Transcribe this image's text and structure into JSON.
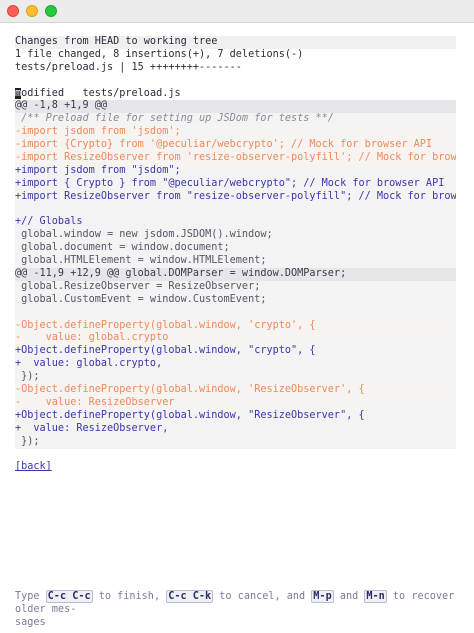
{
  "window": {
    "controls": [
      "close",
      "minimize",
      "maximize"
    ]
  },
  "status": {
    "title": "Changes from HEAD to working tree",
    "summary": "1 file changed, 8 insertions(+), 7 deletions(-)",
    "stat": "tests/preload.js | 15 ++++++++-------"
  },
  "file": {
    "cursor_char": "m",
    "header_rest": "odified   tests/preload.js"
  },
  "diff": [
    {
      "type": "hunk",
      "text": "@@ -1,8 +1,9 @@"
    },
    {
      "type": "ctx-comment",
      "text": " /** Preload file for setting up JSDom for tests **/"
    },
    {
      "type": "removed",
      "text": "-import jsdom from 'jsdom';"
    },
    {
      "type": "removed",
      "text": "-import {Crypto} from '@peculiar/webcrypto'; // Mock for browser API"
    },
    {
      "type": "removed",
      "text": "-import ResizeObserver from 'resize-observer-polyfill'; // Mock for browser API"
    },
    {
      "type": "added",
      "text": "+import jsdom from \"jsdom\";"
    },
    {
      "type": "added",
      "text": "+import { Crypto } from \"@peculiar/webcrypto\"; // Mock for browser API"
    },
    {
      "type": "added",
      "text": "+import ResizeObserver from \"resize-observer-polyfill\"; // Mock for browser API"
    },
    {
      "type": "blank",
      "text": ""
    },
    {
      "type": "added",
      "text": "+// Globals"
    },
    {
      "type": "ctx",
      "text": " global.window = new jsdom.JSDOM().window;"
    },
    {
      "type": "ctx",
      "text": " global.document = window.document;"
    },
    {
      "type": "ctx",
      "text": " global.HTMLElement = window.HTMLElement;"
    },
    {
      "type": "hunk",
      "text": "@@ -11,9 +12,9 @@ global.DOMParser = window.DOMParser;"
    },
    {
      "type": "ctx",
      "text": " global.ResizeObserver = ResizeObserver;"
    },
    {
      "type": "ctx",
      "text": " global.CustomEvent = window.CustomEvent;"
    },
    {
      "type": "blank",
      "text": ""
    },
    {
      "type": "removed",
      "text": "-Object.defineProperty(global.window, 'crypto', {"
    },
    {
      "type": "removed",
      "text": "-    value: global.crypto"
    },
    {
      "type": "added",
      "text": "+Object.defineProperty(global.window, \"crypto\", {"
    },
    {
      "type": "added",
      "text": "+  value: global.crypto,"
    },
    {
      "type": "ctx",
      "text": " });"
    },
    {
      "type": "removed",
      "text": "-Object.defineProperty(global.window, 'ResizeObserver', {"
    },
    {
      "type": "removed",
      "text": "-    value: ResizeObserver"
    },
    {
      "type": "added",
      "text": "+Object.defineProperty(global.window, \"ResizeObserver\", {"
    },
    {
      "type": "added",
      "text": "+  value: ResizeObserver,"
    },
    {
      "type": "ctx",
      "text": " });"
    }
  ],
  "back_link": "[back]",
  "minibuffer": {
    "t1": "Type ",
    "k1": "C-c C-c",
    "t2": " to finish, ",
    "k2": "C-c C-k",
    "t3": " to cancel, and ",
    "k3": "M-p",
    "t4": " and ",
    "k4": "M-n",
    "t5": " to recover older mes-",
    "t6": "sages"
  }
}
